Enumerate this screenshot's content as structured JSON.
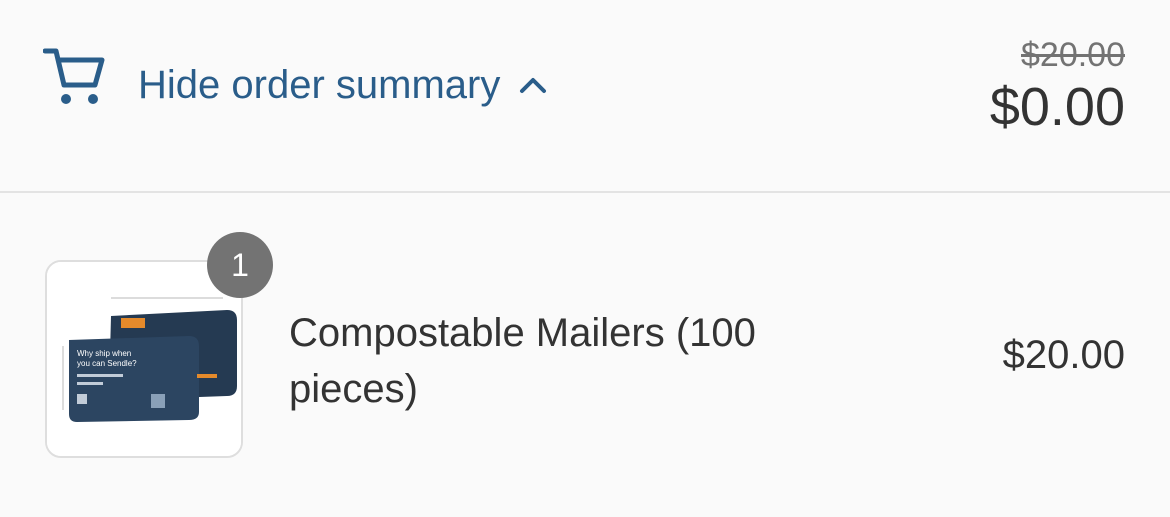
{
  "header": {
    "toggle_label": "Hide order summary",
    "original_total": "$20.00",
    "total": "$0.00",
    "cart_icon": "cart-icon",
    "chevron_icon": "chevron-up-icon"
  },
  "items": [
    {
      "name": "Compostable Mailers (100 pieces)",
      "quantity": "1",
      "price": "$20.00",
      "thumbnail_text": "Why ship when you can Sendle?"
    }
  ],
  "colors": {
    "accent": "#2a5d8a",
    "text": "#333333",
    "muted": "#737373",
    "background": "#fafafa",
    "mailer": "#253a52"
  }
}
